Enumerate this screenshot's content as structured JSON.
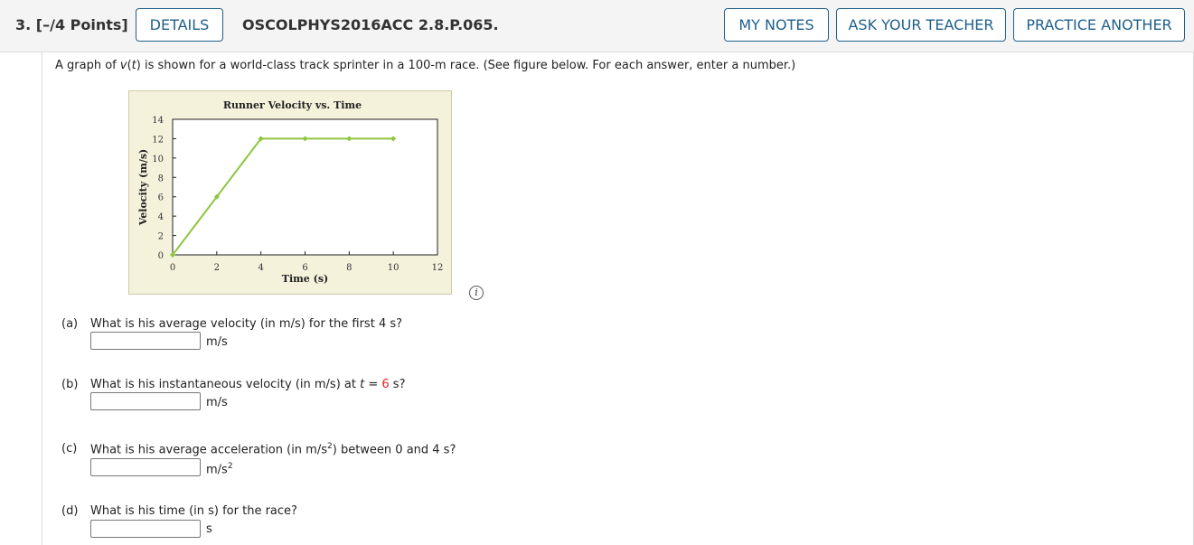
{
  "header": {
    "question_number": "3.",
    "points": "[–/4 Points]",
    "details_label": "DETAILS",
    "code": "OSCOLPHYS2016ACC 2.8.P.065.",
    "my_notes_label": "MY NOTES",
    "ask_teacher_label": "ASK YOUR TEACHER",
    "practice_label": "PRACTICE ANOTHER"
  },
  "intro": {
    "part1": "A graph of ",
    "var": "v",
    "paren_open": "(",
    "t_var": "t",
    "part2": ") is shown for a world-class track sprinter in a 100-m race. (See figure below. For each answer, enter a number.)"
  },
  "chart_data": {
    "type": "line",
    "title": "Runner Velocity vs. Time",
    "xlabel": "Time (s)",
    "ylabel": "Velocity (m/s)",
    "xlim": [
      0,
      12
    ],
    "ylim": [
      0,
      14
    ],
    "xticks": [
      0,
      2,
      4,
      6,
      8,
      10,
      12
    ],
    "yticks": [
      0,
      2,
      4,
      6,
      8,
      10,
      12,
      14
    ],
    "grid": false,
    "series": [
      {
        "x": [
          0,
          2,
          4,
          6,
          8,
          10
        ],
        "y": [
          0,
          6,
          12,
          12,
          12,
          12
        ],
        "color": "#8dc63f"
      }
    ]
  },
  "parts": [
    {
      "label": "(a)",
      "question": "What is his average velocity (in m/s) for the first 4 s?",
      "unit": "m/s",
      "value": ""
    },
    {
      "label": "(b)",
      "q_pre": "What is his instantaneous velocity (in m/s) at ",
      "q_var": "t",
      "q_eq": " = ",
      "q_num": "6",
      "q_post": " s?",
      "unit": "m/s",
      "value": ""
    },
    {
      "label": "(c)",
      "q_pre": "What is his average acceleration (in m/s",
      "q_sup": "2",
      "q_post": ") between 0 and 4 s?",
      "unit": "m/s",
      "unit_sup": "2",
      "value": ""
    },
    {
      "label": "(d)",
      "question": "What is his time (in s) for the race?",
      "unit": "s",
      "value": ""
    }
  ],
  "info_icon": "i"
}
